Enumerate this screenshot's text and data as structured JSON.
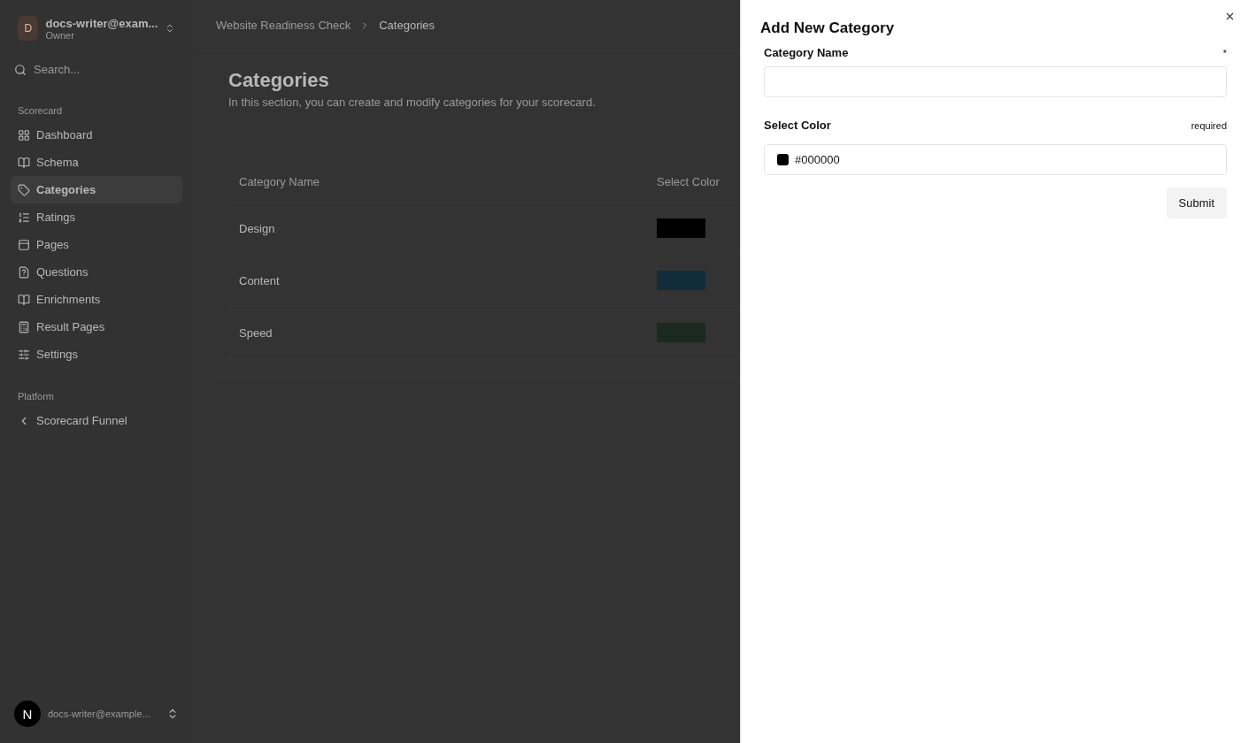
{
  "sidebar": {
    "account": {
      "avatar": "D",
      "email": "docs-writer@exam...",
      "role": "Owner"
    },
    "search": {
      "placeholder": "Search..."
    },
    "sections": [
      {
        "title": "Scorecard",
        "items": [
          {
            "label": "Dashboard",
            "selected": false
          },
          {
            "label": "Schema",
            "selected": false
          },
          {
            "label": "Categories",
            "selected": true
          },
          {
            "label": "Ratings",
            "selected": false
          },
          {
            "label": "Pages",
            "selected": false
          },
          {
            "label": "Questions",
            "selected": false
          },
          {
            "label": "Enrichments",
            "selected": false
          },
          {
            "label": "Result Pages",
            "selected": false
          },
          {
            "label": "Settings",
            "selected": false
          }
        ]
      },
      {
        "title": "Platform",
        "items": [
          {
            "label": "Scorecard Funnel",
            "selected": false
          }
        ]
      }
    ],
    "user": {
      "avatar": "N",
      "email": "docs-writer@example..."
    }
  },
  "breadcrumb": [
    "Website Readiness Check",
    "Categories"
  ],
  "page": {
    "title": "Categories",
    "description": "In this section, you can create and modify categories for your scorecard."
  },
  "table": {
    "columns": [
      "Category Name",
      "Select Color"
    ],
    "rows": [
      {
        "name": "Design",
        "color": "#000000"
      },
      {
        "name": "Content",
        "color": "#132c3b"
      },
      {
        "name": "Speed",
        "color": "#1a2a20"
      }
    ]
  },
  "sheet": {
    "title": "Add New Category",
    "fields": [
      {
        "label": "Category Name",
        "note": "*",
        "kind": "text"
      },
      {
        "label": "Select Color",
        "note": "required",
        "kind": "color",
        "value": "#000000",
        "color": "#000000"
      }
    ],
    "submit": "Submit"
  }
}
